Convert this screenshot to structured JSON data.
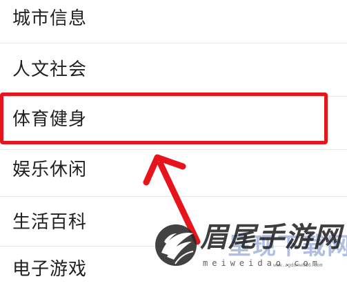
{
  "menu": {
    "items": [
      {
        "label": "城市信息"
      },
      {
        "label": "人文社会"
      },
      {
        "label": "体育健身"
      },
      {
        "label": "娱乐休闲"
      },
      {
        "label": "生活百科"
      },
      {
        "label": "电子游戏"
      }
    ],
    "selected_index": 2
  },
  "annotation": {
    "highlight_color": "#e8141b",
    "pointer": "arrow-up-left"
  },
  "watermark": {
    "title": "眉尾手游网",
    "title_overlay": "呈现下载网",
    "subtitle": "meiweidao.com",
    "url": "www.zgdonw886.com",
    "logo_icon": "leaf-logo-icon"
  }
}
